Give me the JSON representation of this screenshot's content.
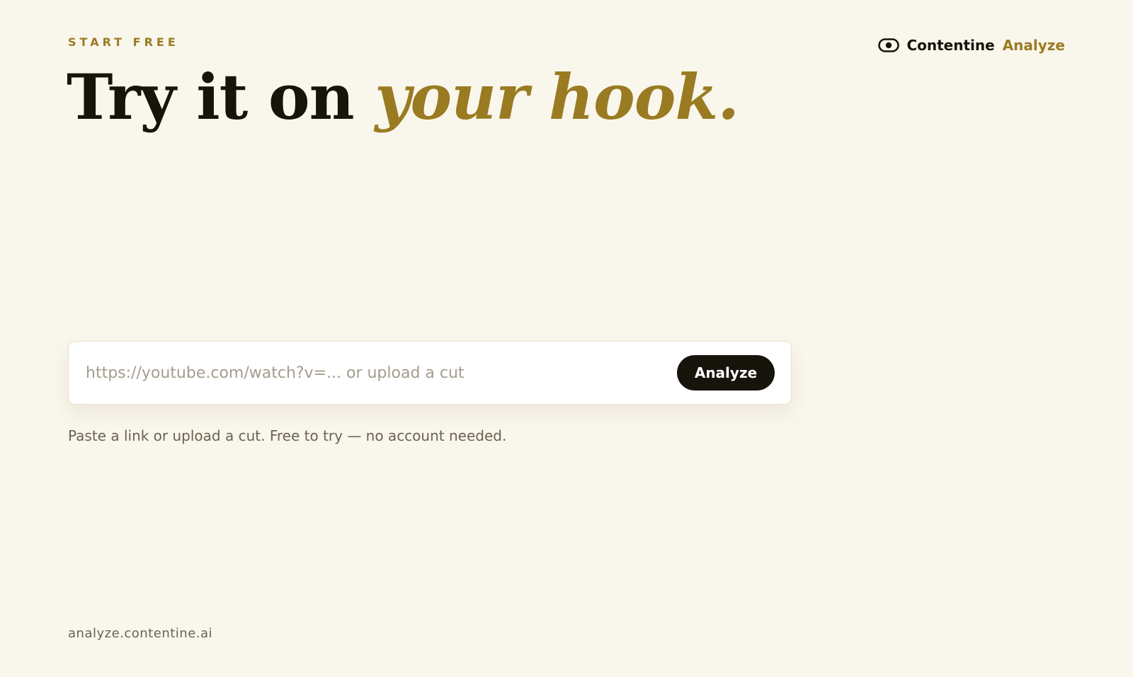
{
  "hero": {
    "eyebrow": "START FREE",
    "headline_main": "Try it on ",
    "headline_accent": "your hook."
  },
  "brand": {
    "icon": "eye-icon",
    "name": "Contentine",
    "product": "Analyze"
  },
  "analyzer": {
    "input_value": "",
    "input_placeholder": "https://youtube.com/watch?v=... or upload a cut",
    "button_label": "Analyze",
    "helper_text": "Paste a link or upload a cut. Free to try — no account needed."
  },
  "footer": {
    "domain": "analyze.contentine.ai"
  },
  "colors": {
    "background": "#f9f6ec",
    "ink": "#17140c",
    "accent": "#9a7b22",
    "muted": "#6b6353",
    "placeholder": "#a49d8d",
    "card": "#ffffff"
  }
}
